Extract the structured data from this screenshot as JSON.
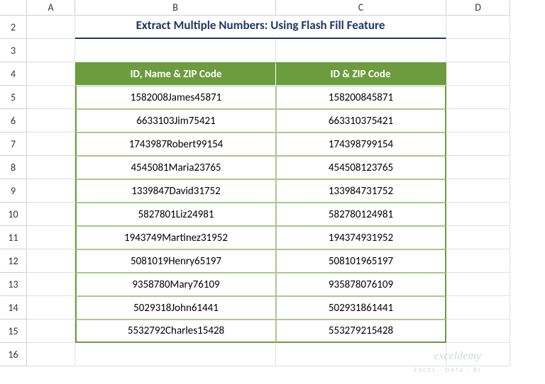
{
  "columns": [
    "A",
    "B",
    "C",
    "D"
  ],
  "rows": [
    2,
    3,
    4,
    5,
    6,
    7,
    8,
    9,
    10,
    11,
    12,
    13,
    14,
    15,
    16
  ],
  "title": "Extract Multiple Numbers: Using Flash Fill Feature",
  "headers": {
    "b": "ID, Name & ZIP Code",
    "c": "ID & ZIP Code"
  },
  "data": [
    {
      "b": "1582008James45871",
      "c": "158200845871"
    },
    {
      "b": "6633103Jim75421",
      "c": "663310375421"
    },
    {
      "b": "1743987Robert99154",
      "c": "174398799154"
    },
    {
      "b": "4545081Maria23765",
      "c": "454508123765"
    },
    {
      "b": "1339847David31752",
      "c": "133984731752"
    },
    {
      "b": "5827801Liz24981",
      "c": "582780124981"
    },
    {
      "b": "1943749Martinez31952",
      "c": "194374931952"
    },
    {
      "b": "5081019Henry65197",
      "c": "508101965197"
    },
    {
      "b": "9358780Mary76109",
      "c": "935878076109"
    },
    {
      "b": "5029318John61441",
      "c": "502931861441"
    },
    {
      "b": "5532792Charles15428",
      "c": "553279215428"
    }
  ],
  "watermark": {
    "main": "exceldemy",
    "sub": "EXCEL · DATA · BI"
  }
}
